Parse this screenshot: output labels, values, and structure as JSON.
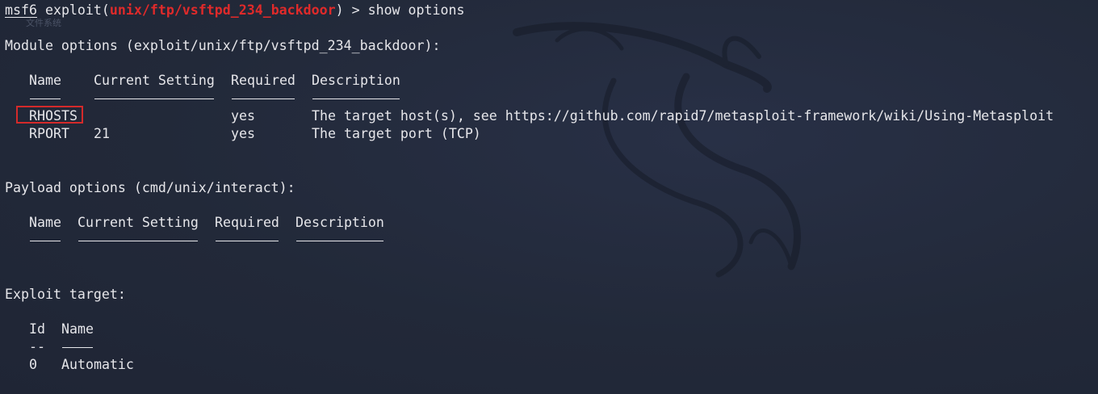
{
  "overlay": {
    "ghost_text": "文件系统"
  },
  "prompt": {
    "name": "msf6",
    "command_prefix": " exploit(",
    "module_path": "unix/ftp/vsftpd_234_backdoor",
    "command_suffix": ") > show options"
  },
  "module_options": {
    "heading": "Module options (exploit/unix/ftp/vsftpd_234_backdoor):",
    "headers": {
      "name": "Name",
      "setting": "Current Setting",
      "required": "Required",
      "description": "Description"
    },
    "rows": [
      {
        "name": "RHOSTS",
        "setting": "",
        "required": "yes",
        "description": "The target host(s), see https://github.com/rapid7/metasploit-framework/wiki/Using-Metasploit"
      },
      {
        "name": "RPORT",
        "setting": "21",
        "required": "yes",
        "description": "The target port (TCP)"
      }
    ]
  },
  "payload_options": {
    "heading": "Payload options (cmd/unix/interact):",
    "headers": {
      "name": "Name",
      "setting": "Current Setting",
      "required": "Required",
      "description": "Description"
    }
  },
  "exploit_target": {
    "heading": "Exploit target:",
    "headers": {
      "id": "Id",
      "name": "Name"
    },
    "id_dash": "--",
    "rows": [
      {
        "id": "0",
        "name": "Automatic"
      }
    ]
  },
  "colors": {
    "highlight_box": "#d42a2a",
    "module_path": "#e02a2a",
    "background": "#232a3a"
  }
}
